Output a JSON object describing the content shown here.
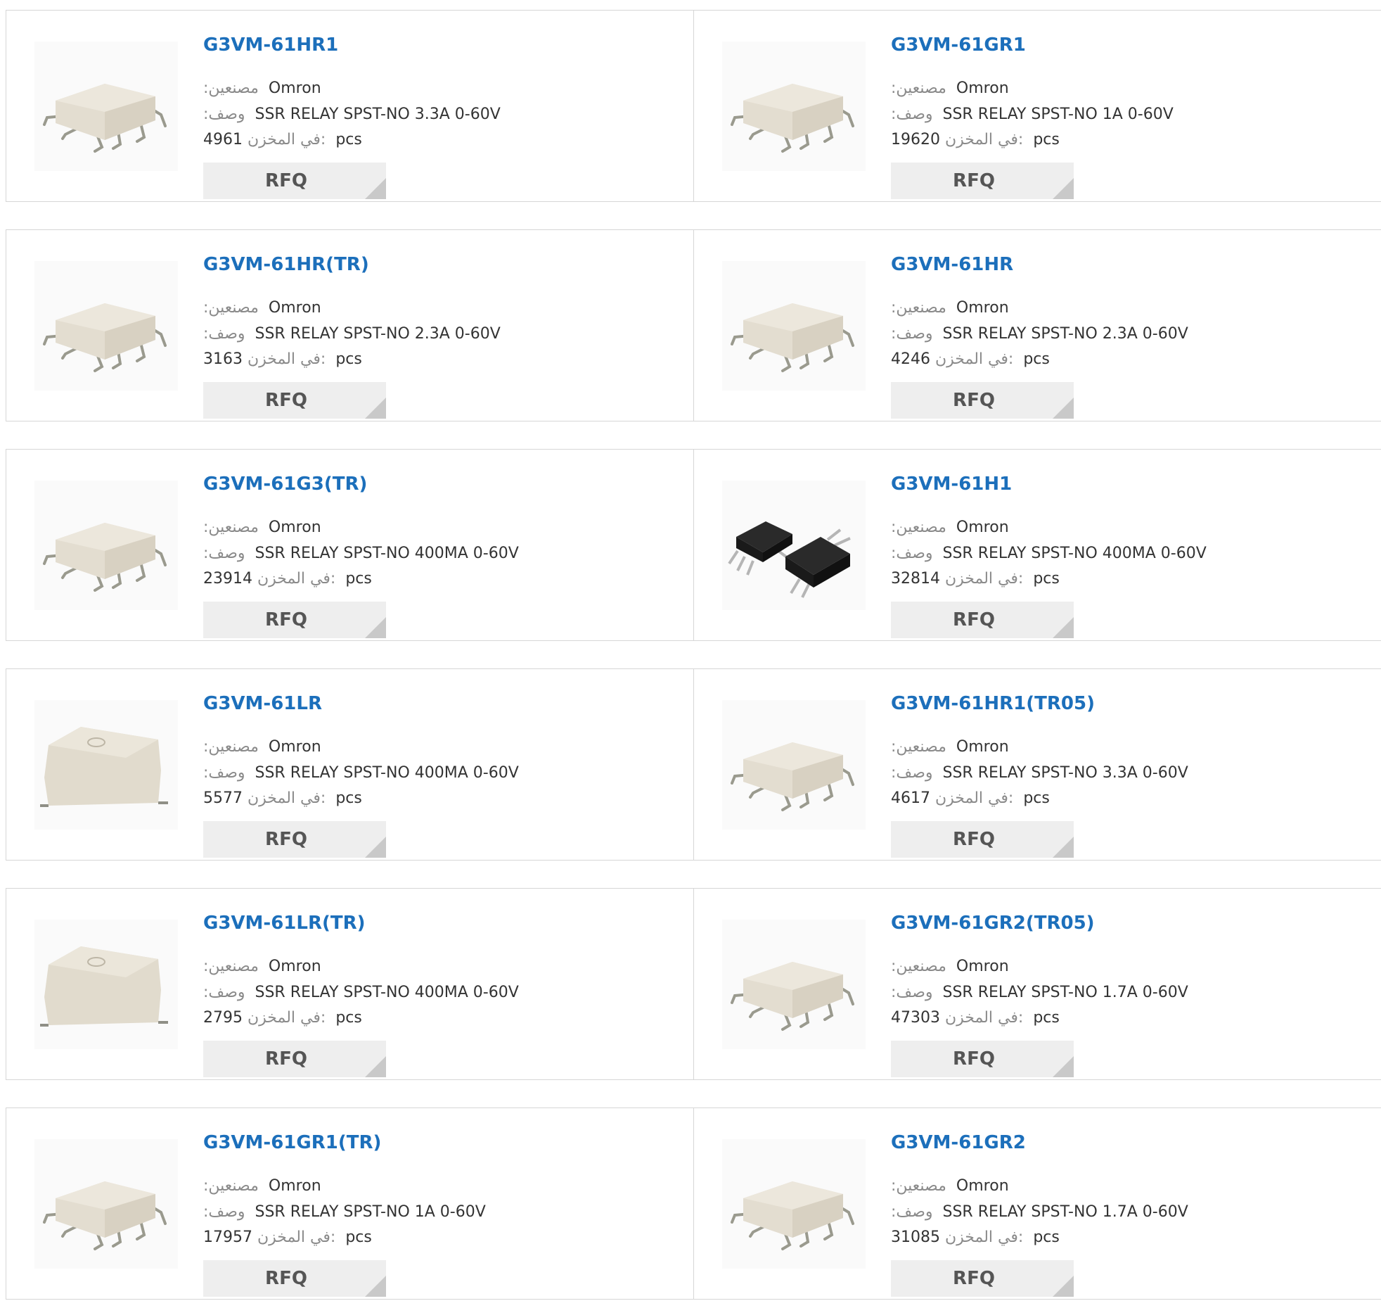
{
  "labels": {
    "manufacturer": ":مصنعين",
    "description": ":وصف",
    "stock": "في المخزن:",
    "unit": "pcs",
    "rfq": "RFQ"
  },
  "products": [
    {
      "part": "G3VM-61HR1",
      "manufacturer": "Omron",
      "description": "SSR RELAY SPST-NO 3.3A 0-60V",
      "stock": "4961",
      "image": "relay-chip-beige-icon"
    },
    {
      "part": "G3VM-61GR1",
      "manufacturer": "Omron",
      "description": "SSR RELAY SPST-NO 1A 0-60V",
      "stock": "19620",
      "image": "relay-chip-beige-icon"
    },
    {
      "part": "G3VM-61HR(TR)",
      "manufacturer": "Omron",
      "description": "SSR RELAY SPST-NO 2.3A 0-60V",
      "stock": "3163",
      "image": "relay-chip-beige-icon"
    },
    {
      "part": "G3VM-61HR",
      "manufacturer": "Omron",
      "description": "SSR RELAY SPST-NO 2.3A 0-60V",
      "stock": "4246",
      "image": "relay-chip-beige-icon"
    },
    {
      "part": "G3VM-61G3(TR)",
      "manufacturer": "Omron",
      "description": "SSR RELAY SPST-NO 400MA 0-60V",
      "stock": "23914",
      "image": "relay-chip-beige-icon"
    },
    {
      "part": "G3VM-61H1",
      "manufacturer": "Omron",
      "description": "SSR RELAY SPST-NO 400MA 0-60V",
      "stock": "32814",
      "image": "relay-chip-black-pair-icon"
    },
    {
      "part": "G3VM-61LR",
      "manufacturer": "Omron",
      "description": "SSR RELAY SPST-NO 400MA 0-60V",
      "stock": "5577",
      "image": "relay-block-beige-icon"
    },
    {
      "part": "G3VM-61HR1(TR05)",
      "manufacturer": "Omron",
      "description": "SSR RELAY SPST-NO 3.3A 0-60V",
      "stock": "4617",
      "image": "relay-chip-beige-icon"
    },
    {
      "part": "G3VM-61LR(TR)",
      "manufacturer": "Omron",
      "description": "SSR RELAY SPST-NO 400MA 0-60V",
      "stock": "2795",
      "image": "relay-block-beige-icon"
    },
    {
      "part": "G3VM-61GR2(TR05)",
      "manufacturer": "Omron",
      "description": "SSR RELAY SPST-NO 1.7A 0-60V",
      "stock": "47303",
      "image": "relay-chip-beige-icon"
    },
    {
      "part": "G3VM-61GR1(TR)",
      "manufacturer": "Omron",
      "description": "SSR RELAY SPST-NO 1A 0-60V",
      "stock": "17957",
      "image": "relay-chip-beige-icon"
    },
    {
      "part": "G3VM-61GR2",
      "manufacturer": "Omron",
      "description": "SSR RELAY SPST-NO 1.7A 0-60V",
      "stock": "31085",
      "image": "relay-chip-beige-icon"
    }
  ],
  "colors": {
    "title": "#1c6fbb",
    "label": "#8a8a8a",
    "button_bg": "#eeeeee",
    "border": "#d6d6d6"
  }
}
